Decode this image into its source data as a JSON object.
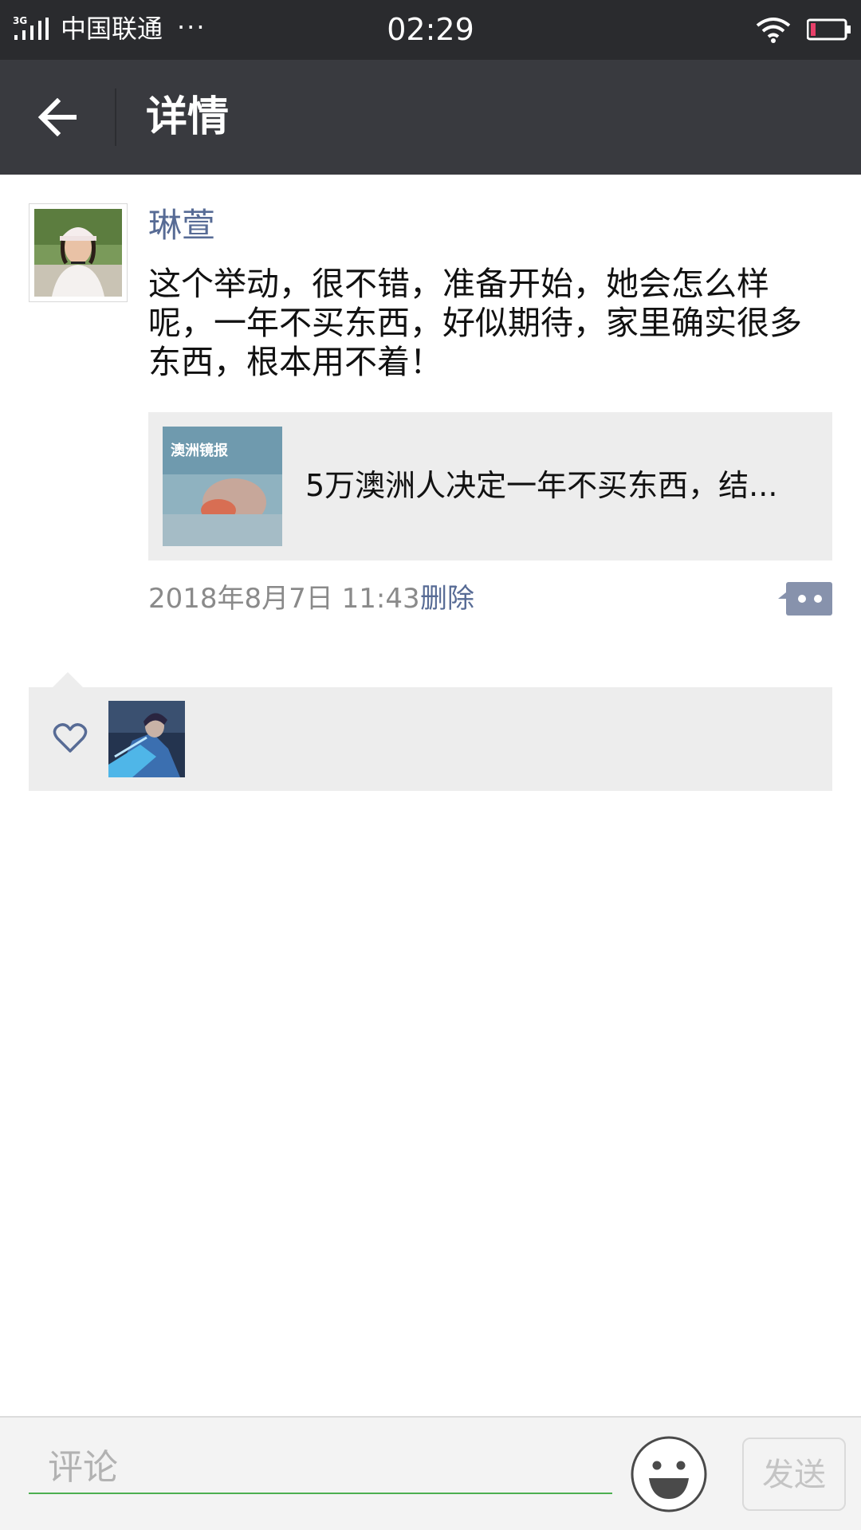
{
  "status_bar": {
    "network": "3G",
    "carrier": "中国联通",
    "dots": "···",
    "time": "02:29",
    "icons": [
      "signal-icon",
      "wifi-icon",
      "battery-icon"
    ]
  },
  "header": {
    "title": "详情",
    "back_icon": "back-arrow-icon"
  },
  "post": {
    "author": "琳萱",
    "text": "这个举动，很不错，准备开始，她会怎么样呢，一年不买东西，好似期待，家里确实很多东西，根本用不着！",
    "shared_link": {
      "thumb_text": "澳洲镜报",
      "title": "5万澳洲人决定一年不买东西，结..."
    },
    "timestamp": "2018年8月7日 11:43",
    "delete_label": "删除",
    "comment_icon": "comment-bubble-icon"
  },
  "likes": {
    "icon": "heart-icon",
    "avatars": [
      "liker-avatar"
    ]
  },
  "comment_bar": {
    "placeholder": "评论",
    "emoji_icon": "emoji-icon",
    "send_label": "发送"
  },
  "colors": {
    "status_bar_bg": "#2a2b2e",
    "header_bg": "#393a3f",
    "link_blue": "#576b95",
    "input_underline": "#4caf50",
    "card_bg": "#ededed"
  }
}
